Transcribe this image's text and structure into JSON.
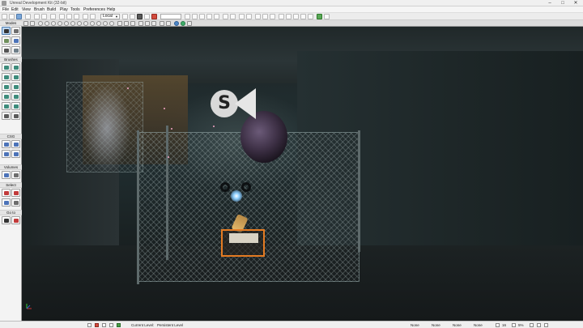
{
  "window": {
    "title": "Unreal Development Kit (32-bit)",
    "controls": {
      "minimize": "–",
      "maximize": "□",
      "close": "✕"
    }
  },
  "menu": {
    "items": [
      {
        "label": "File"
      },
      {
        "label": "Edit"
      },
      {
        "label": "View"
      },
      {
        "label": "Brush"
      },
      {
        "label": "Build"
      },
      {
        "label": "Play"
      },
      {
        "label": "Tools"
      },
      {
        "label": "Preferences"
      },
      {
        "label": "Help"
      }
    ]
  },
  "toolbar": {
    "coordinate_system": "Local"
  },
  "left_panel": {
    "sections": {
      "modes": "Modes",
      "brushes": "Brushes",
      "csg": "CSG",
      "volumes": "Volumes",
      "select": "Select",
      "goto": "Go to"
    }
  },
  "viewport": {
    "sound_icon_letter": "S"
  },
  "status_bar": {
    "current_level_label": "Current Level:",
    "current_level_value": "Persistent Level",
    "fields": [
      "None",
      "None",
      "None",
      "None"
    ],
    "grid_size": "16",
    "rotation_snap": "5%"
  },
  "colors": {
    "trigger_outline": "#e47b22",
    "selection_blue": "#4f7fb2"
  }
}
